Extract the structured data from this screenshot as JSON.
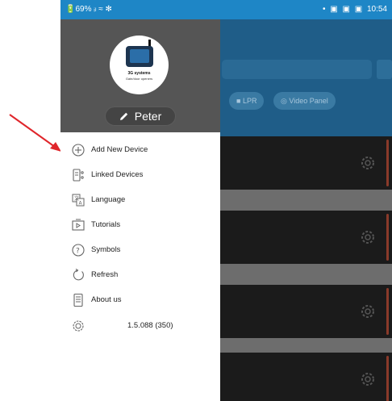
{
  "status_bar": {
    "left": "🔋69% ᵢₗ ≈ ✻",
    "right_icons": [
      "•",
      "▣",
      "▣",
      "▣"
    ],
    "time": "10:54",
    "color": "#1e86c6"
  },
  "drawer": {
    "logo": {
      "title": "3G systems",
      "subtitle": "Gate/door openers"
    },
    "user_name": "Peter",
    "menu": [
      {
        "label": "Add New Device",
        "icon": "add-circle-icon"
      },
      {
        "label": "Linked Devices",
        "icon": "linked-devices-icon"
      },
      {
        "label": "Language",
        "icon": "language-icon"
      },
      {
        "label": "Tutorials",
        "icon": "tutorials-icon"
      },
      {
        "label": "Symbols",
        "icon": "symbols-icon"
      },
      {
        "label": "Refresh",
        "icon": "refresh-icon"
      },
      {
        "label": "About us",
        "icon": "about-icon"
      },
      {
        "label": "1.5.088 (350)",
        "icon": "version-icon"
      }
    ]
  },
  "background": {
    "chips": [
      "LPR",
      "Video Panel"
    ],
    "card_count": 4
  },
  "annotation": {
    "arrow_color": "#e0262b"
  }
}
